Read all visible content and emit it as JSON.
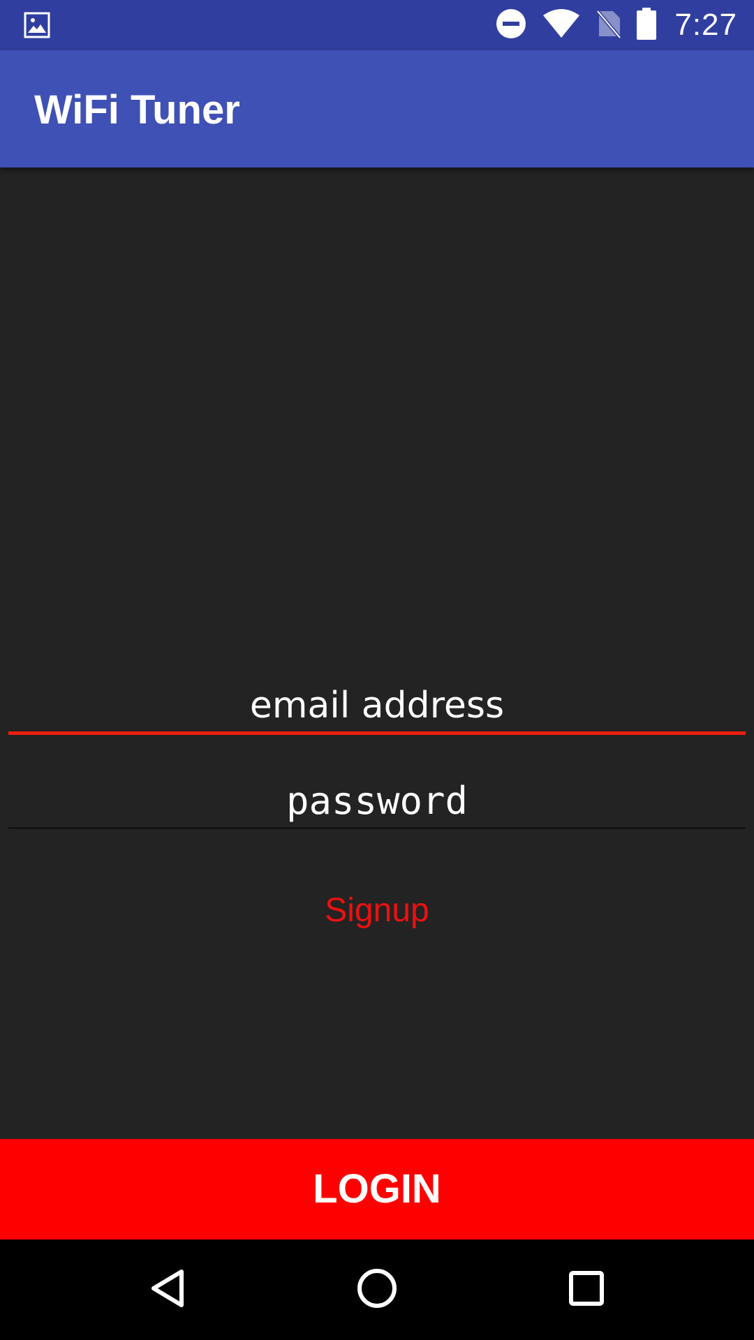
{
  "status_bar": {
    "time": "7:27",
    "icons": [
      "image-notification-icon",
      "do-not-disturb-icon",
      "wifi-icon",
      "no-sim-icon",
      "battery-icon"
    ]
  },
  "app_bar": {
    "title": "WiFi Tuner"
  },
  "form": {
    "email_placeholder": "email address",
    "password_placeholder": "password",
    "signup_label": "Signup"
  },
  "login_button": {
    "label": "LOGIN"
  },
  "nav_bar": {
    "icons": [
      "back-icon",
      "home-icon",
      "recents-icon"
    ]
  },
  "colors": {
    "status_bar": "#303f9f",
    "app_bar": "#3f51b5",
    "background": "#232323",
    "accent": "#ff0000",
    "email_underline": "#ee1f0f",
    "signup_text": "#ee1010"
  }
}
